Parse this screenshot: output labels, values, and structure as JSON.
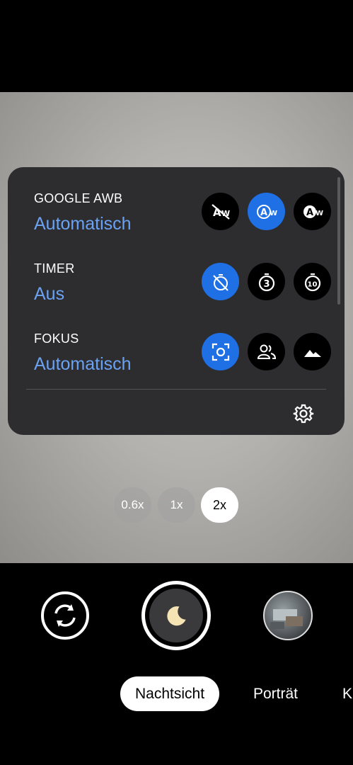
{
  "settings": {
    "awb": {
      "label": "GOOGLE AWB",
      "value": "Automatisch",
      "options": [
        "awb-off-icon",
        "awb-auto-icon",
        "awb-manual-icon"
      ],
      "active_index": 1
    },
    "timer": {
      "label": "TIMER",
      "value": "Aus",
      "options": [
        "timer-off-icon",
        "timer-3s-icon",
        "timer-10s-icon"
      ],
      "active_index": 0
    },
    "focus": {
      "label": "FOKUS",
      "value": "Automatisch",
      "options": [
        "focus-auto-icon",
        "focus-people-icon",
        "focus-landscape-icon"
      ],
      "active_index": 0
    }
  },
  "zoom": {
    "levels": [
      "0.6x",
      "1x",
      "2x"
    ],
    "selected": "2x"
  },
  "modes": {
    "items": [
      "Nachtsicht",
      "Porträt",
      "K"
    ],
    "selected": "Nachtsicht"
  },
  "colors": {
    "accent": "#1f6fe5",
    "value_text": "#6aa2f4",
    "panel": "#2d2d2f"
  }
}
